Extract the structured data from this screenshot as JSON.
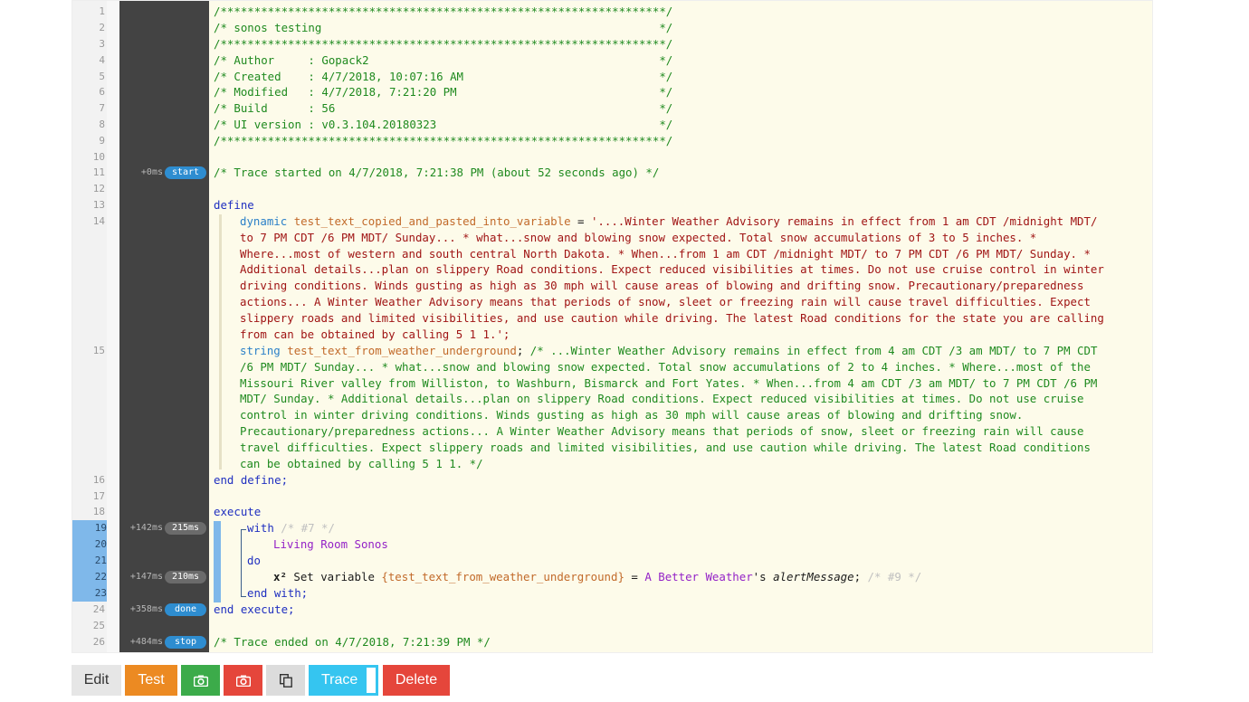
{
  "editor": {
    "line_numbers": [
      "1",
      "2",
      "3",
      "4",
      "5",
      "6",
      "7",
      "8",
      "9",
      "10",
      "11",
      "12",
      "13",
      "14",
      "15",
      "16",
      "17",
      "18",
      "19",
      "20",
      "21",
      "22",
      "23",
      "24",
      "25",
      "26"
    ],
    "trace": {
      "start": {
        "ms": "+0ms",
        "label": "start"
      },
      "with": {
        "ms": "+142ms",
        "label": "215ms"
      },
      "setvar": {
        "ms": "+147ms",
        "label": "210ms"
      },
      "done": {
        "ms": "+358ms",
        "label": "done"
      },
      "stop": {
        "ms": "+484ms",
        "label": "stop"
      }
    },
    "header": [
      "/******************************************************************/",
      "/* sonos testing                                                  */",
      "/******************************************************************/",
      "/* Author     : Gopack2                                           */",
      "/* Created    : 4/7/2018, 10:07:16 AM                             */",
      "/* Modified   : 4/7/2018, 7:21:20 PM                              */",
      "/* Build      : 56                                                */",
      "/* UI version : v0.3.104.20180323                                 */",
      "/******************************************************************/"
    ],
    "trace_started": "/* Trace started on 4/7/2018, 7:21:38 PM (about 52 seconds ago) */",
    "define_kw": "define",
    "var1": {
      "type": "dynamic",
      "name": "test_text_copied_and_pasted_into_variable",
      "eq": " = ",
      "first": "'....Winter Weather Advisory remains in effect from 1 am CDT /midnight MDT/",
      "rest": [
        "to 7 PM CDT /6 PM MDT/ Sunday... * what...snow and blowing snow expected. Total snow accumulations of 3 to 5 inches. *",
        "Where...most of western and south central North Dakota. * When...from 1 am CDT /midnight MDT/ to 7 PM CDT /6 PM MDT/ Sunday. *",
        "Additional details...plan on slippery Road conditions. Expect reduced visibilities at times. Do not use cruise control in winter",
        "driving conditions. Winds gusting as high as 30 mph will cause areas of blowing and drifting snow. Precautionary/preparedness",
        "actions... A Winter Weather Advisory means that periods of snow, sleet or freezing rain will cause travel difficulties. Expect",
        "slippery roads and limited visibilities, and use caution while driving. The latest Road conditions for the state you are calling",
        "from can be obtained by calling 5 1 1.';"
      ]
    },
    "var2": {
      "type": "string",
      "name": "test_text_from_weather_underground",
      "semi": "; ",
      "first": "/* ...Winter Weather Advisory remains in effect from 4 am CDT /3 am MDT/ to 7 PM CDT",
      "rest": [
        "/6 PM MDT/ Sunday... * what...snow and blowing snow expected. Total snow accumulations of 2 to 4 inches. * Where...most of the",
        "Missouri River valley from Williston, to Washburn, Bismarck and Fort Yates. * When...from 4 am CDT /3 am MDT/ to 7 PM CDT /6 PM",
        "MDT/ Sunday. * Additional details...plan on slippery Road conditions. Expect reduced visibilities at times. Do not use cruise",
        "control in winter driving conditions. Winds gusting as high as 30 mph will cause areas of blowing and drifting snow.",
        "Precautionary/preparedness actions... A Winter Weather Advisory means that periods of snow, sleet or freezing rain will cause",
        "travel difficulties. Expect slippery roads and limited visibilities, and use caution while driving. The latest Road conditions",
        "can be obtained by calling 5 1 1. */"
      ]
    },
    "end_define": "end define;",
    "execute_kw": "execute",
    "with_kw": "with",
    "with_comment": " /* #7 */",
    "device": "Living Room Sonos",
    "do_kw": "do",
    "set_icon": "x²",
    "set_text": " Set variable ",
    "set_var": "{test_text_from_weather_underground}",
    "set_eq": " = ",
    "set_dev": "A Better Weather",
    "set_poss": "'s ",
    "set_attr": "alertMessage",
    "set_semi": "; ",
    "set_comment": "/* #9 */",
    "end_with": "end with;",
    "end_execute": "end execute;",
    "trace_ended": "/* Trace ended on 4/7/2018, 7:21:39 PM */"
  },
  "toolbar": {
    "edit": "Edit",
    "test": "Test",
    "camera_icon": "camera-icon",
    "camera_red_icon": "camera-icon",
    "copy_icon": "copy-icon",
    "trace": "Trace",
    "delete": "Delete"
  },
  "colors": {
    "edit_bg": "#e6e6e6",
    "test_bg": "#ec8a22",
    "camera_bg": "#3cab4a",
    "camera_red_bg": "#e5463b",
    "copy_bg": "#dcdcdc",
    "trace_bg": "#35c5f0",
    "delete_bg": "#e5463b"
  }
}
